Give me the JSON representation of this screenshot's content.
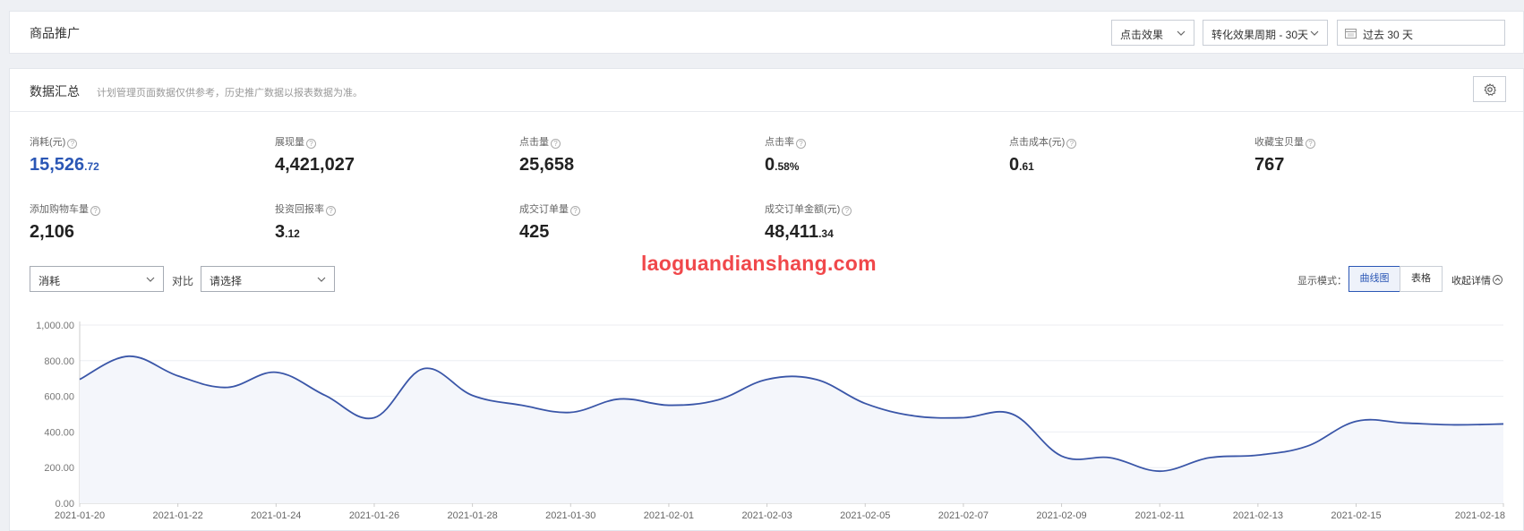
{
  "header": {
    "title": "商品推广",
    "effect_select": "点击效果",
    "cycle_select": "转化效果周期 - 30天",
    "date_range": "过去 30 天"
  },
  "summary": {
    "title": "数据汇总",
    "subtitle": "计划管理页面数据仅供参考，历史推广数据以报表数据为准。",
    "help_mark": "?",
    "metrics": [
      {
        "label": "消耗(元)",
        "int": "15,526",
        "dec": ".72"
      },
      {
        "label": "展现量",
        "int": "4,421,027",
        "dec": ""
      },
      {
        "label": "点击量",
        "int": "25,658",
        "dec": ""
      },
      {
        "label": "点击率",
        "int": "0",
        "dec": ".58%"
      },
      {
        "label": "点击成本(元)",
        "int": "0",
        "dec": ".61"
      },
      {
        "label": "收藏宝贝量",
        "int": "767",
        "dec": ""
      },
      {
        "label": "添加购物车量",
        "int": "2,106",
        "dec": ""
      },
      {
        "label": "投资回报率",
        "int": "3",
        "dec": ".12"
      },
      {
        "label": "成交订单量",
        "int": "425",
        "dec": ""
      },
      {
        "label": "成交订单金额(元)",
        "int": "48,411",
        "dec": ".34"
      }
    ]
  },
  "controls": {
    "metric_select": "消耗",
    "compare_label": "对比",
    "compare_select": "请选择",
    "mode_label": "显示模式：",
    "mode_curve": "曲线图",
    "mode_table": "表格",
    "collapse": "收起详情"
  },
  "watermark": "laoguandianshang.com",
  "colors": {
    "accent": "#2b57b5",
    "line": "#3a56a8",
    "watermark": "#f0484b"
  },
  "chart_data": {
    "type": "line",
    "y_ticks": [
      "1,000.00",
      "800.00",
      "600.00",
      "400.00",
      "200.00",
      "0.00"
    ],
    "ylim": [
      0,
      1000
    ],
    "grid": true,
    "x": [
      "2021-01-20",
      "2021-01-21",
      "2021-01-22",
      "2021-01-23",
      "2021-01-24",
      "2021-01-25",
      "2021-01-26",
      "2021-01-27",
      "2021-01-28",
      "2021-01-29",
      "2021-01-30",
      "2021-01-31",
      "2021-02-01",
      "2021-02-02",
      "2021-02-03",
      "2021-02-04",
      "2021-02-05",
      "2021-02-06",
      "2021-02-07",
      "2021-02-08",
      "2021-02-09",
      "2021-02-10",
      "2021-02-11",
      "2021-02-12",
      "2021-02-13",
      "2021-02-14",
      "2021-02-15",
      "2021-02-16",
      "2021-02-17",
      "2021-02-18"
    ],
    "x_tick_labels": [
      "2021-01-20",
      "2021-01-22",
      "2021-01-24",
      "2021-01-26",
      "2021-01-28",
      "2021-01-30",
      "2021-02-01",
      "2021-02-03",
      "2021-02-05",
      "2021-02-07",
      "2021-02-09",
      "2021-02-11",
      "2021-02-13",
      "2021-02-15",
      "2021-02-18"
    ],
    "series": [
      {
        "values": [
          695,
          825,
          715,
          650,
          735,
          605,
          480,
          755,
          605,
          550,
          510,
          585,
          550,
          580,
          695,
          695,
          560,
          490,
          480,
          500,
          265,
          255,
          180,
          255,
          270,
          320,
          460,
          450,
          440,
          445
        ]
      }
    ]
  }
}
